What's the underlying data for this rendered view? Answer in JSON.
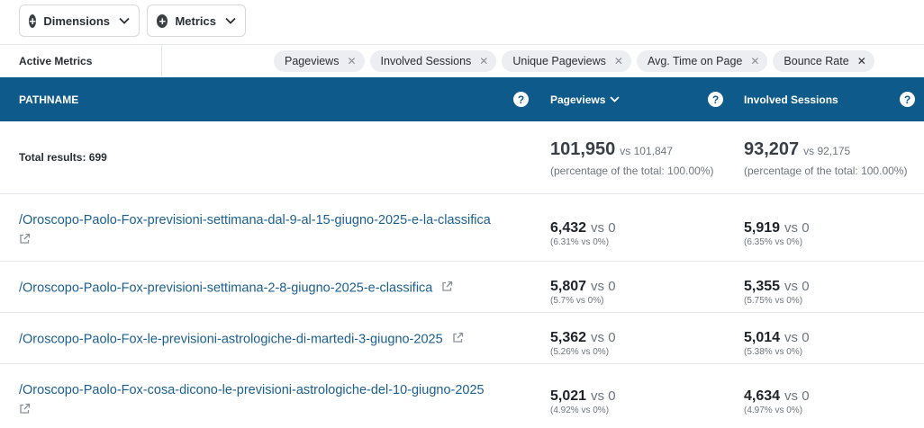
{
  "toolbar": {
    "dimensions_label": "Dimensions",
    "metrics_label": "Metrics"
  },
  "active_metrics": {
    "label": "Active Metrics",
    "chips": [
      {
        "label": "Pageviews"
      },
      {
        "label": "Involved Sessions"
      },
      {
        "label": "Unique Pageviews"
      },
      {
        "label": "Avg. Time on Page"
      },
      {
        "label": "Bounce Rate"
      }
    ]
  },
  "table": {
    "columns": {
      "pathname": "PATHNAME",
      "pageviews": "Pageviews",
      "involved_sessions": "Involved Sessions"
    },
    "total": {
      "label": "Total results: 699",
      "pageviews": {
        "value": "101,950",
        "vs": "vs 101,847",
        "pct": "(percentage of the total: 100.00%)"
      },
      "involved_sessions": {
        "value": "93,207",
        "vs": "vs 92,175",
        "pct": "(percentage of the total: 100.00%)"
      }
    },
    "rows": [
      {
        "path": "/Oroscopo-Paolo-Fox-previsioni-settimana-dal-9-al-15-giugno-2025-e-la-classifica",
        "pageviews": {
          "value": "6,432",
          "vs": "vs 0",
          "pct": "(6.31% vs 0%)"
        },
        "sessions": {
          "value": "5,919",
          "vs": "vs 0",
          "pct": "(6.35% vs 0%)"
        }
      },
      {
        "path": "/Oroscopo-Paolo-Fox-previsioni-settimana-2-8-giugno-2025-e-classifica",
        "pageviews": {
          "value": "5,807",
          "vs": "vs 0",
          "pct": "(5.7% vs 0%)"
        },
        "sessions": {
          "value": "5,355",
          "vs": "vs 0",
          "pct": "(5.75% vs 0%)"
        }
      },
      {
        "path": "/Oroscopo-Paolo-Fox-le-previsioni-astrologiche-di-martedi-3-giugno-2025",
        "pageviews": {
          "value": "5,362",
          "vs": "vs 0",
          "pct": "(5.26% vs 0%)"
        },
        "sessions": {
          "value": "5,014",
          "vs": "vs 0",
          "pct": "(5.38% vs 0%)"
        }
      },
      {
        "path": "/Oroscopo-Paolo-Fox-cosa-dicono-le-previsioni-astrologiche-del-10-giugno-2025",
        "pageviews": {
          "value": "5,021",
          "vs": "vs 0",
          "pct": "(4.92% vs 0%)"
        },
        "sessions": {
          "value": "4,634",
          "vs": "vs 0",
          "pct": "(4.97% vs 0%)"
        }
      }
    ]
  },
  "colors": {
    "header_bg": "#0e5a8a",
    "link": "#1b5f91",
    "chip_bg": "#eceef1"
  },
  "icons": [
    "plus-circle-icon",
    "chevron-down-icon",
    "close-icon",
    "help-icon",
    "external-link-icon"
  ]
}
